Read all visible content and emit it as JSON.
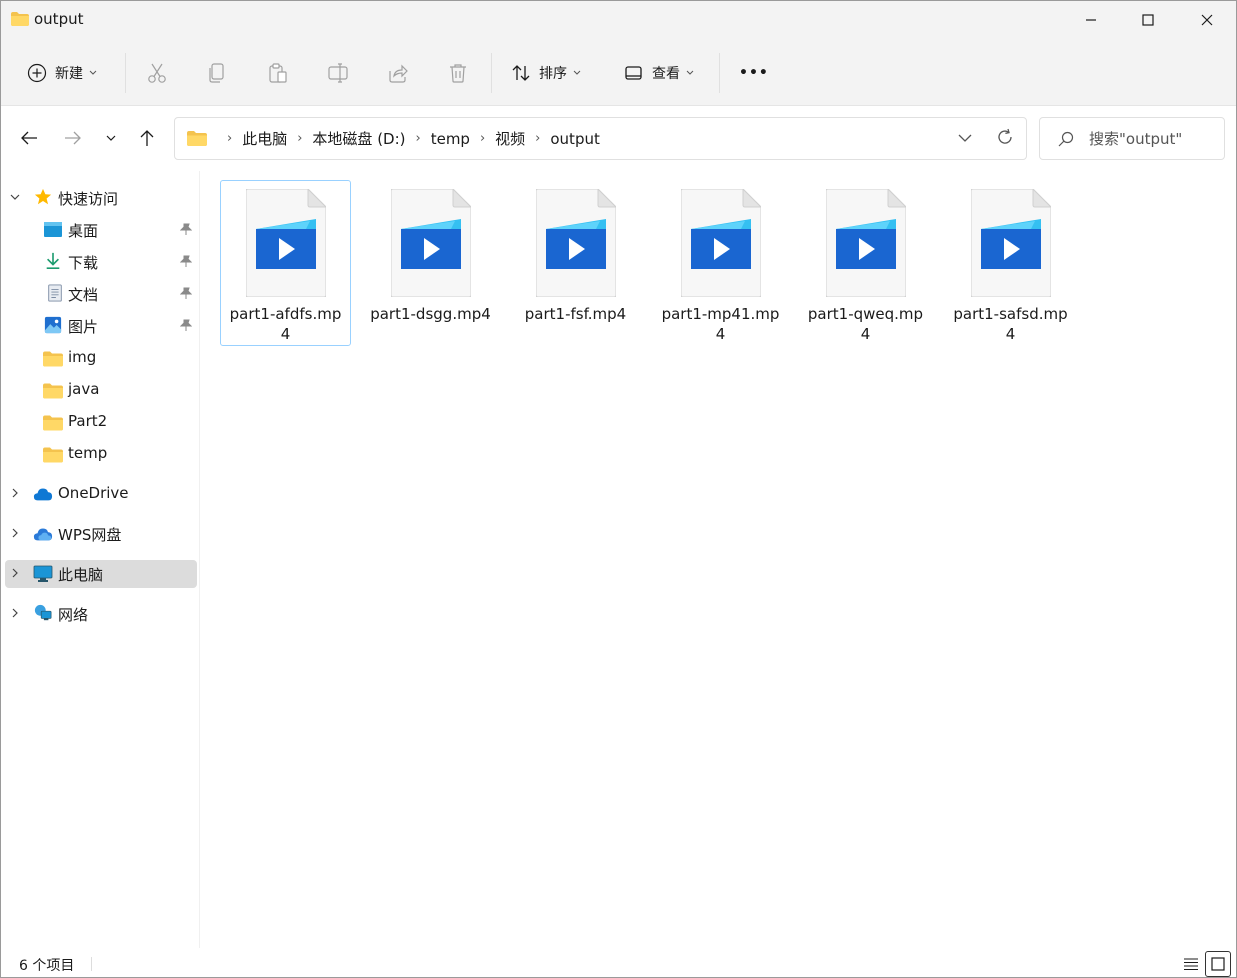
{
  "window": {
    "title": "output",
    "accent": "#0067c0"
  },
  "toolbar": {
    "new_label": "新建",
    "sort_label": "排序",
    "view_label": "查看",
    "more_label": "•••",
    "icons": [
      "cut-icon",
      "copy-icon",
      "paste-icon",
      "rename-icon",
      "share-icon",
      "delete-icon"
    ]
  },
  "address": {
    "crumbs": [
      "此电脑",
      "本地磁盘 (D:)",
      "temp",
      "视频",
      "output"
    ],
    "search_placeholder": "搜索\"output\""
  },
  "sidebar": {
    "quick_access": "快速访问",
    "pinned": [
      {
        "label": "桌面",
        "icon": "desktop-icon"
      },
      {
        "label": "下载",
        "icon": "download-icon"
      },
      {
        "label": "文档",
        "icon": "document-icon"
      },
      {
        "label": "图片",
        "icon": "picture-icon"
      }
    ],
    "folders": [
      "img",
      "java",
      "Part2",
      "temp"
    ],
    "onedrive": "OneDrive",
    "wps": "WPS网盘",
    "this_pc": "此电脑",
    "network": "网络"
  },
  "files": [
    {
      "name": "part1-afdfs.mp4",
      "selected": true
    },
    {
      "name": "part1-dsgg.mp4",
      "selected": false
    },
    {
      "name": "part1-fsf.mp4",
      "selected": false
    },
    {
      "name": "part1-mp41.mp4",
      "selected": false
    },
    {
      "name": "part1-qweq.mp4",
      "selected": false
    },
    {
      "name": "part1-safsd.mp4",
      "selected": false
    }
  ],
  "status": {
    "item_count": "6 个项目"
  }
}
